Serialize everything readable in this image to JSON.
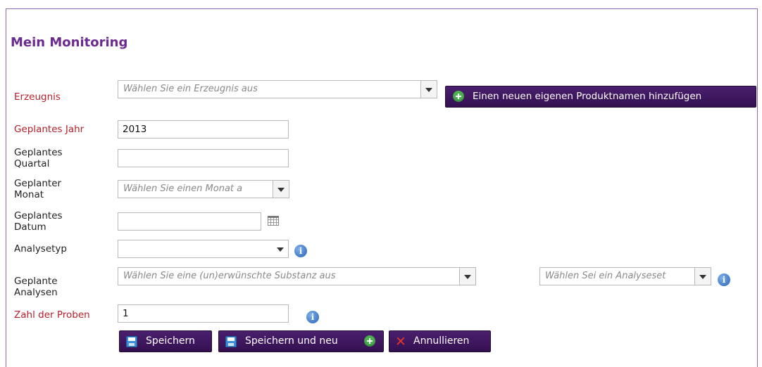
{
  "page": {
    "title": "Mein Monitoring"
  },
  "form": {
    "erzeugnis": {
      "label": "Erzeugnis",
      "placeholder": "Wählen Sie ein Erzeugnis aus",
      "add_button_label": "Einen neuen eigenen Produktnamen hinzufügen"
    },
    "jahr": {
      "label": "Geplantes Jahr",
      "value": "2013"
    },
    "quartal": {
      "label_line1": "Geplantes",
      "label_line2": "Quartal",
      "value": ""
    },
    "monat": {
      "label_line1": "Geplanter",
      "label_line2": "Monat",
      "placeholder": "Wählen Sie einen Monat a"
    },
    "datum": {
      "label_line1": "Geplantes",
      "label_line2": "Datum",
      "value": ""
    },
    "analysetyp": {
      "label": "Analysetyp",
      "value": ""
    },
    "analysen": {
      "label_line1": "Geplante",
      "label_line2": "Analysen",
      "substanz_placeholder": "Wählen Sie eine (un)erwünschte Substanz aus",
      "analyseset_placeholder": "Wählen Sei ein Analyseset"
    },
    "proben": {
      "label": "Zahl der Proben",
      "value": "1"
    }
  },
  "actions": {
    "save": "Speichern",
    "save_new": "Speichern und neu",
    "cancel": "Annullieren"
  },
  "colors": {
    "title": "#6b2a8f",
    "required_label": "#b5202a",
    "button_bg": "#3c1459",
    "add_icon": "#4caf50",
    "cancel_icon": "#e0352b",
    "info_icon": "#2a63b8"
  }
}
